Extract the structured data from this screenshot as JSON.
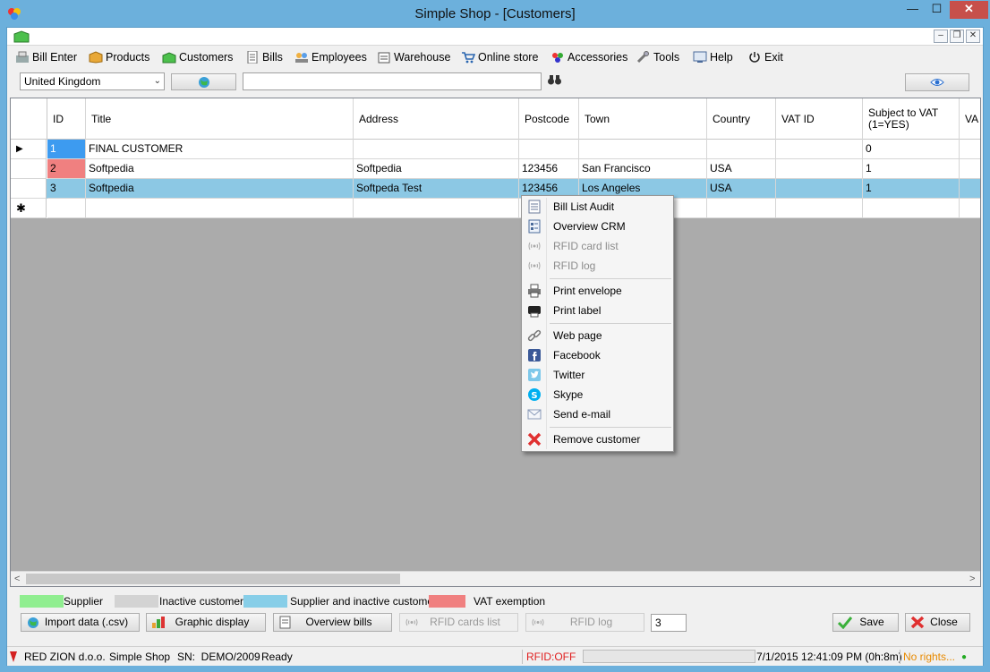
{
  "window": {
    "title": "Simple Shop - [Customers]",
    "minimize": "—",
    "maximize": "☐",
    "close": "✕"
  },
  "mdi": {
    "minimize": "–",
    "restore": "❐",
    "close": "✕"
  },
  "menu": [
    {
      "label": "Bill Enter",
      "icon": "cash-register-icon"
    },
    {
      "label": "Products",
      "icon": "box-icon"
    },
    {
      "label": "Customers",
      "icon": "customers-icon"
    },
    {
      "label": "Bills",
      "icon": "document-icon"
    },
    {
      "label": "Employees",
      "icon": "employees-icon"
    },
    {
      "label": "Warehouse",
      "icon": "warehouse-icon"
    },
    {
      "label": "Online store",
      "icon": "cart-icon"
    },
    {
      "label": "Accessories",
      "icon": "accessories-icon"
    },
    {
      "label": "Tools",
      "icon": "tools-icon"
    },
    {
      "label": "Help",
      "icon": "help-icon"
    },
    {
      "label": "Exit",
      "icon": "power-icon"
    }
  ],
  "filter": {
    "country": "United Kingdom",
    "search_value": ""
  },
  "grid": {
    "columns": [
      "ID",
      "Title",
      "Address",
      "Postcode",
      "Town",
      "Country",
      "VAT ID",
      "Subject to VAT\n(1=YES)",
      "VA"
    ],
    "rows": [
      {
        "marker": "▶",
        "id": "1",
        "title": "FINAL CUSTOMER",
        "address": "",
        "postcode": "",
        "town": "",
        "country": "",
        "vat_id": "",
        "subject_vat": "0",
        "id_color": "#3d9bf0"
      },
      {
        "marker": "",
        "id": "2",
        "title": "Softpedia",
        "address": "Softpedia",
        "postcode": "123456",
        "town": "San Francisco",
        "country": "USA",
        "vat_id": "",
        "subject_vat": "1",
        "id_color": "#f08080"
      },
      {
        "marker": "",
        "id": "3",
        "title": "Softpedia",
        "address": "Softpeda Test",
        "postcode": "123456",
        "town": "Los Angeles",
        "country": "USA",
        "vat_id": "",
        "subject_vat": "1",
        "id_color": ""
      }
    ],
    "new_row_marker": "✱"
  },
  "context_menu": {
    "items": [
      {
        "label": "Bill List Audit",
        "enabled": true,
        "icon": "audit-list-icon"
      },
      {
        "label": "Overview CRM",
        "enabled": true,
        "icon": "crm-icon"
      },
      {
        "label": "RFID card list",
        "enabled": false,
        "icon": "rfid-icon"
      },
      {
        "label": "RFID log",
        "enabled": false,
        "icon": "rfid-log-icon"
      },
      {
        "label": "Print envelope",
        "enabled": true,
        "icon": "printer-icon"
      },
      {
        "label": "Print label",
        "enabled": true,
        "icon": "label-printer-icon"
      },
      {
        "label": "Web page",
        "enabled": true,
        "icon": "link-icon"
      },
      {
        "label": "Facebook",
        "enabled": true,
        "icon": "facebook-icon"
      },
      {
        "label": "Twitter",
        "enabled": true,
        "icon": "twitter-icon"
      },
      {
        "label": "Skype",
        "enabled": true,
        "icon": "skype-icon"
      },
      {
        "label": "Send e-mail",
        "enabled": true,
        "icon": "email-icon"
      },
      {
        "label": "Remove customer",
        "enabled": true,
        "icon": "remove-icon"
      }
    ]
  },
  "legend": [
    {
      "label": "Supplier",
      "color": "#90ee90"
    },
    {
      "label": "Inactive customer",
      "color": "#d3d3d3"
    },
    {
      "label": "Supplier and inactive customer",
      "color": "#87cee8"
    },
    {
      "label": "VAT exemption",
      "color": "#f08080"
    }
  ],
  "buttons": {
    "import": "Import data (.csv)",
    "graphic": "Graphic display",
    "overview": "Overview bills",
    "rfid_cards": "RFID cards list",
    "rfid_log": "RFID log",
    "count": "3",
    "save": "Save",
    "close": "Close"
  },
  "status": {
    "company": "RED ZION d.o.o.",
    "app": "Simple Shop",
    "sn": "SN:  DEMO/2009",
    "state": "Ready",
    "rfid": "RFID:OFF",
    "datetime": "7/1/2015 12:41:09 PM (0h:8m)",
    "rights": "No rights...",
    "dot": "●"
  }
}
